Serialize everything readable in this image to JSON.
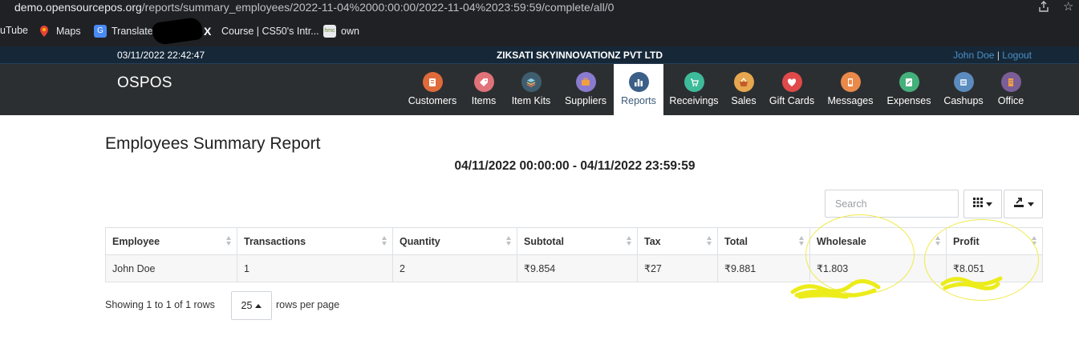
{
  "browser": {
    "url_host": "demo.opensourcepos.org",
    "url_path": "/reports/summary_employees/2022-11-04%2000:00:00/2022-11-04%2023:59:59/complete/all/0",
    "share_icon": "share-icon",
    "star_icon": "star-icon",
    "bookmarks": [
      {
        "label": "uTube",
        "icon": "youtube-icon"
      },
      {
        "label": "Maps",
        "icon": "maps-icon"
      },
      {
        "label": "Translate",
        "icon": "translate-icon"
      },
      {
        "label": "Course | CS50's Intr...",
        "icon": "edx-icon"
      },
      {
        "label": "own",
        "icon": "hmc-icon"
      }
    ]
  },
  "topbar": {
    "datetime": "03/11/2022 22:42:47",
    "company": "ZIKSATI SKYINNOVATIONZ PVT LTD",
    "user": "John Doe",
    "separator": "|",
    "logout": "Logout"
  },
  "navbar": {
    "brand": "OSPOS",
    "items": [
      {
        "label": "Customers",
        "icon": "customers-icon",
        "color": "#e06b3a",
        "active": false
      },
      {
        "label": "Items",
        "icon": "items-icon",
        "color": "#e0727a",
        "active": false
      },
      {
        "label": "Item Kits",
        "icon": "item-kits-icon",
        "color": "#3e5e70",
        "active": false
      },
      {
        "label": "Suppliers",
        "icon": "suppliers-icon",
        "color": "#8a7ad0",
        "active": false
      },
      {
        "label": "Reports",
        "icon": "reports-icon",
        "color": "#3c5f88",
        "active": true
      },
      {
        "label": "Receivings",
        "icon": "receivings-icon",
        "color": "#3dbb9a",
        "active": false
      },
      {
        "label": "Sales",
        "icon": "sales-icon",
        "color": "#e7a74e",
        "active": false
      },
      {
        "label": "Gift Cards",
        "icon": "gift-cards-icon",
        "color": "#e04a4a",
        "active": false
      },
      {
        "label": "Messages",
        "icon": "messages-icon",
        "color": "#e98a4a",
        "active": false
      },
      {
        "label": "Expenses",
        "icon": "expenses-icon",
        "color": "#44b07c",
        "active": false
      },
      {
        "label": "Cashups",
        "icon": "cashups-icon",
        "color": "#5b8bbf",
        "active": false
      },
      {
        "label": "Office",
        "icon": "office-icon",
        "color": "#7b5e97",
        "active": false
      }
    ]
  },
  "report": {
    "title": "Employees Summary Report",
    "date_range": "04/11/2022 00:00:00 - 04/11/2022 23:59:59",
    "search_placeholder": "Search",
    "columns": [
      "Employee",
      "Transactions",
      "Quantity",
      "Subtotal",
      "Tax",
      "Total",
      "Wholesale",
      "Profit"
    ],
    "rows": [
      [
        "John Doe",
        "1",
        "2",
        "₹9.854",
        "₹27",
        "₹9.881",
        "₹1.803",
        "₹8.051"
      ]
    ],
    "pagination": {
      "showing": "Showing 1 to 1 of 1 rows",
      "page_size": "25",
      "rows_per_page": "rows per page"
    }
  },
  "annotation_color": "#f0ea4a"
}
